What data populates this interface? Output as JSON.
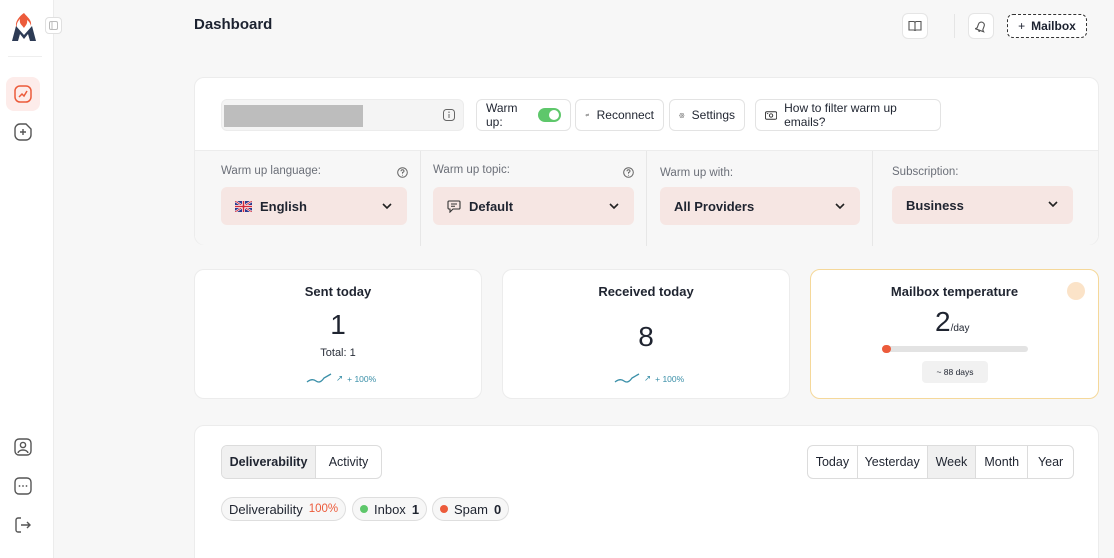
{
  "header": {
    "title": "Dashboard",
    "add_mailbox_label": "+ Mailbox",
    "add_mailbox_text": "Mailbox"
  },
  "mailbox": {
    "warmup_label": "Warm up:",
    "warmup_enabled": true,
    "reconnect_label": "Reconnect",
    "settings_label": "Settings",
    "filter_help_label": "How to filter warm up emails?"
  },
  "settings": {
    "language": {
      "label": "Warm up language:",
      "value": "English"
    },
    "topic": {
      "label": "Warm up topic:",
      "value": "Default"
    },
    "providers": {
      "label": "Warm up with:",
      "value": "All Providers"
    },
    "subscription": {
      "label": "Subscription:",
      "value": "Business"
    }
  },
  "stats": {
    "sent": {
      "title": "Sent today",
      "value": "1",
      "total": "Total: 1",
      "trend": "+ 100%"
    },
    "received": {
      "title": "Received today",
      "value": "8",
      "trend": "+ 100%"
    },
    "temperature": {
      "title": "Mailbox temperature",
      "value": "2",
      "unit": "/day",
      "days": "~ 88 days",
      "level": 0.04
    }
  },
  "chart_tabs": [
    "Deliverability",
    "Activity"
  ],
  "active_chart_tab": "Deliverability",
  "periods": [
    "Today",
    "Yesterday",
    "Week",
    "Month",
    "Year"
  ],
  "active_period": "Week",
  "metrics": {
    "deliverability": {
      "label": "Deliverability",
      "value": "100%"
    },
    "inbox": {
      "label": "Inbox",
      "value": "1"
    },
    "spam": {
      "label": "Spam",
      "value": "0"
    }
  },
  "colors": {
    "accent": "#ec5b3b",
    "inbox": "#5ec76b",
    "spam": "#ec5b3b",
    "trend": "#3a8fa8",
    "toggle_on": "#5ec76b"
  },
  "icons": {
    "sidebar": [
      "dashboard-chart-icon",
      "add-document-icon",
      "user-profile-icon",
      "chat-icon",
      "logout-icon"
    ],
    "top": [
      "book-icon",
      "bell-icon"
    ]
  }
}
